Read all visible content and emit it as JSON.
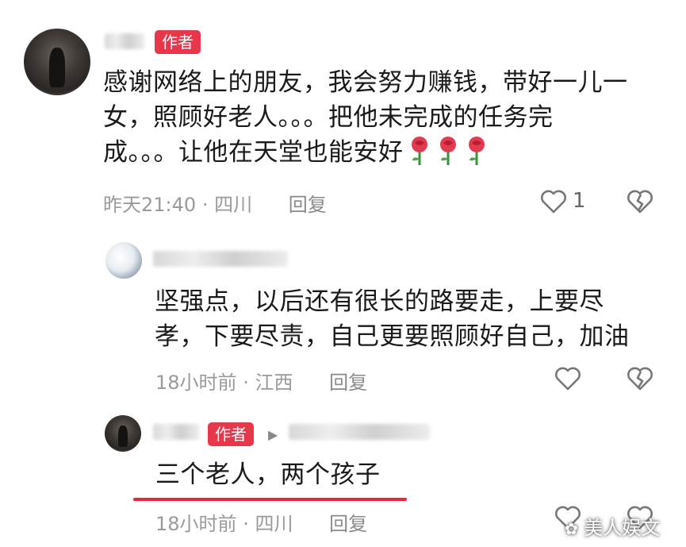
{
  "comments": [
    {
      "badge": "作者",
      "text_lines": [
        "感谢网络上的朋友，我会努力赚钱，带好一儿一",
        "女，照顾好老人。。。把他未完成的任务完",
        "成。。。让他在天堂也能安好"
      ],
      "time": "昨天21:40",
      "location": "四川",
      "reply_label": "回复",
      "like_count": "1"
    },
    {
      "text_lines": [
        "坚强点，以后还有很长的路要走，上要尽",
        "孝，下要尽责，自己更要照顾好自己，加油"
      ],
      "time": "18小时前",
      "location": "江西",
      "reply_label": "回复"
    },
    {
      "badge": "作者",
      "text_lines": [
        "三个老人，两个孩子"
      ],
      "time": "18小时前",
      "location": "四川",
      "reply_label": "回复"
    }
  ],
  "meta_separator": "·",
  "watermark": "美人娱文",
  "colors": {
    "badge_bg": "#e8364a",
    "underline": "#e8273c",
    "meta_text": "#9a9a9a"
  }
}
